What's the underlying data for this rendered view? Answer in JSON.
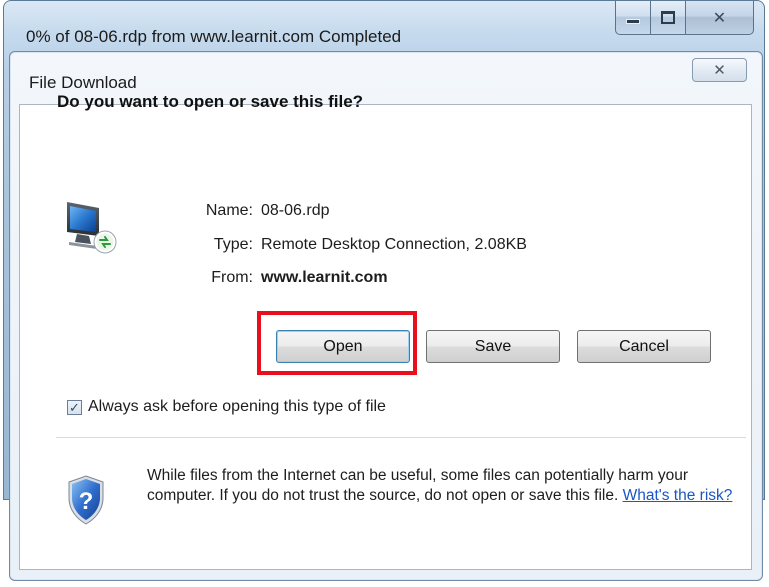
{
  "outer_window": {
    "title": "0% of 08-06.rdp from www.learnit.com Completed",
    "caption_buttons": {
      "minimize_icon": "minimize-icon",
      "maximize_icon": "maximize-icon",
      "close_glyph": "✕"
    }
  },
  "dialog": {
    "title": "File Download",
    "close_glyph": "✕",
    "question": "Do you want to open or save this file?",
    "file_icon": "remote-desktop-icon",
    "info": {
      "name_label": "Name:",
      "name_value": "08-06.rdp",
      "type_label": "Type:",
      "type_value": "Remote Desktop Connection, 2.08KB",
      "from_label": "From:",
      "from_value": "www.learnit.com"
    },
    "buttons": {
      "open": "Open",
      "save": "Save",
      "cancel": "Cancel"
    },
    "checkbox": {
      "checked": true,
      "label": "Always ask before opening this type of file"
    },
    "warning": {
      "text": "While files from the Internet can be useful, some files can potentially harm your computer. If you do not trust the source, do not open or save this file.",
      "link": "What's the risk?"
    }
  },
  "colors": {
    "highlight": "#e8101a",
    "link": "#1a56c4"
  }
}
